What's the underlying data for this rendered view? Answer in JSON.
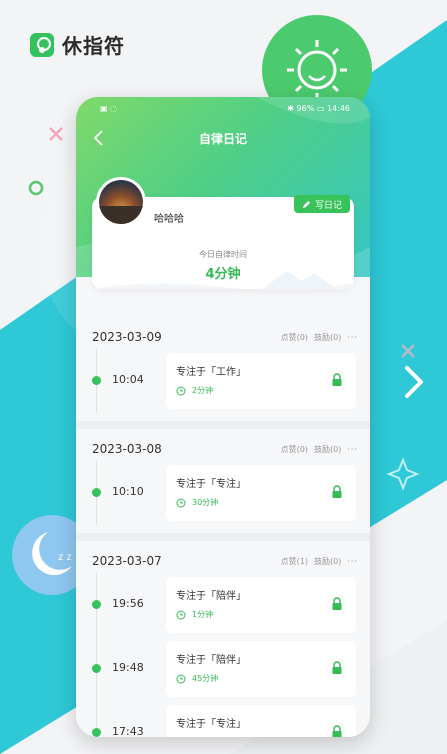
{
  "app": {
    "name": "休指符",
    "brand_color": "#33c35e",
    "accent_teal": "#2fc9d8"
  },
  "status_bar": {
    "left": "▣ ◌",
    "right": "✱ 96% ▭ 14:46"
  },
  "nav": {
    "title": "自律日记",
    "back_icon": "chevron-left-icon"
  },
  "profile": {
    "username": "哈哈哈",
    "write_button": "写日记",
    "today_label": "今日自律时间",
    "today_value": "4分钟"
  },
  "days": [
    {
      "date": "2023-03-09",
      "likes": "点赞(0)",
      "cheers": "鼓励(0)",
      "more": "···",
      "entries": [
        {
          "time": "10:04",
          "title": "专注于「工作」",
          "duration": "2分钟"
        }
      ]
    },
    {
      "date": "2023-03-08",
      "likes": "点赞(0)",
      "cheers": "鼓励(0)",
      "more": "···",
      "entries": [
        {
          "time": "10:10",
          "title": "专注于「专注」",
          "duration": "30分钟"
        }
      ]
    },
    {
      "date": "2023-03-07",
      "likes": "点赞(1)",
      "cheers": "鼓励(0)",
      "more": "···",
      "entries": [
        {
          "time": "19:56",
          "title": "专注于「陪伴」",
          "duration": "1分钟"
        },
        {
          "time": "19:48",
          "title": "专注于「陪伴」",
          "duration": "45分钟"
        },
        {
          "time": "17:43",
          "title": "专注于「专注」",
          "duration": ""
        }
      ]
    }
  ]
}
